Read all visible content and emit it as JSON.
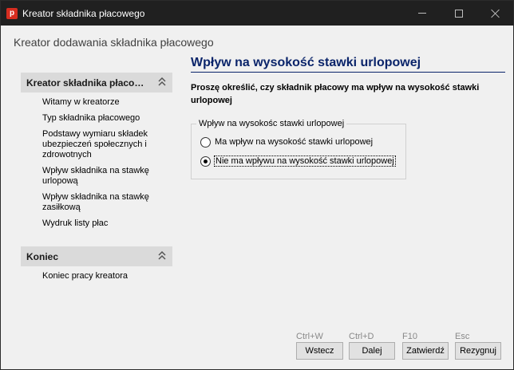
{
  "window": {
    "title": "Kreator składnika płacowego",
    "app_icon_letter": "p",
    "controls": {
      "minimize": "minimize-icon",
      "maximize": "maximize-icon",
      "close": "close-icon"
    }
  },
  "wizard": {
    "header": "Kreator dodawania składnika płacowego"
  },
  "sidebar": {
    "panel1": {
      "title": "Kreator składnika płaco…",
      "items": [
        "Witamy w kreatorze",
        "Typ składnika płacowego",
        "Podstawy wymiaru składek ubezpieczeń społecznych i zdrowotnych",
        "Wpływ składnika na stawkę urlopową",
        "Wpływ składnika na stawkę zasiłkową",
        "Wydruk listy płac"
      ]
    },
    "panel2": {
      "title": "Koniec",
      "items": [
        "Koniec pracy kreatora"
      ]
    }
  },
  "main": {
    "title": "Wpływ na wysokość stawki urlopowej",
    "prompt": "Proszę określić, czy składnik płacowy ma wpływ na wysokość stawki urlopowej",
    "group": {
      "legend": "Wpływ na wysokośc stawki urlopowej",
      "options": [
        {
          "label": "Ma wpływ na wysokość stawki urlopowej",
          "selected": false
        },
        {
          "label": "Nie ma wpływu na wysokość stawki urlopowej",
          "selected": true
        }
      ]
    }
  },
  "footer": {
    "back": {
      "label": "Wstecz",
      "shortcut": "Ctrl+W"
    },
    "next": {
      "label": "Dalej",
      "shortcut": "Ctrl+D"
    },
    "confirm": {
      "label": "Zatwierdź",
      "shortcut": "F10"
    },
    "cancel": {
      "label": "Rezygnuj",
      "shortcut": "Esc"
    }
  },
  "colors": {
    "title_blue": "#0a246a",
    "titlebar": "#202020",
    "app_icon": "#d62d20"
  }
}
